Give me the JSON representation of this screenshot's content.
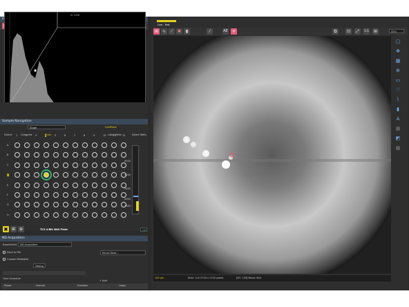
{
  "lut_panel": {
    "title": "LUTs",
    "header_readout": "G: 1.00",
    "x_ticks": [
      "500",
      "1000",
      "1500",
      "2000",
      "2500",
      "3000",
      "3500",
      "4000"
    ],
    "left_ticks": [
      "0",
      "0",
      "0"
    ]
  },
  "sample_nav": {
    "title": "Sample Navigation",
    "stage_label": "Stage",
    "hold_label": "HoldPlate",
    "tabs": [
      "Detect",
      "Overview",
      "Scan"
    ],
    "label_wells": "Label Wells",
    "select_wells": "Select Wells",
    "rows": [
      "A",
      "B",
      "C",
      "D",
      "E",
      "F",
      "G",
      "H"
    ],
    "cols": [
      "1",
      "2",
      "3",
      "4",
      "5",
      "6",
      "7",
      "8",
      "9",
      "10",
      "11",
      "12"
    ],
    "selected": {
      "row": "D",
      "col": "4"
    },
    "z_ticks": [
      "5000",
      "4000",
      "3000",
      "2000",
      "1000"
    ],
    "plate_name": "TC3 4-Blk Well Plate",
    "ok_label": "OK"
  },
  "acquisition": {
    "title": "ND Acquisition",
    "experiment_label": "Experiment",
    "experiment_value": "ND Acquisition",
    "save_to_file": "Save to File",
    "custom_metadata": "Custom Metadata",
    "reuse_label": "Reuse Data...",
    "timing_label": "Timing",
    "time_schedule": "Time Schedule",
    "add_label": "+ Add",
    "columns": [
      "Phase",
      "Interval",
      "Duration",
      "Loops"
    ]
  },
  "viewer": {
    "tab_title": "Live - Fast",
    "ae_label": "AE",
    "ratio_label": "1:1",
    "zoom_label": "32%",
    "status_left": "100 μm",
    "status_mid": "Num: 1ch  2720 x 2720 pixels",
    "status_right": "[NT, C/M]  Mono: 8bit"
  },
  "colors": {
    "accent_yellow": "#e2d21a",
    "selected_well": "#2bb673",
    "titlebar": "#3b4a5a"
  }
}
